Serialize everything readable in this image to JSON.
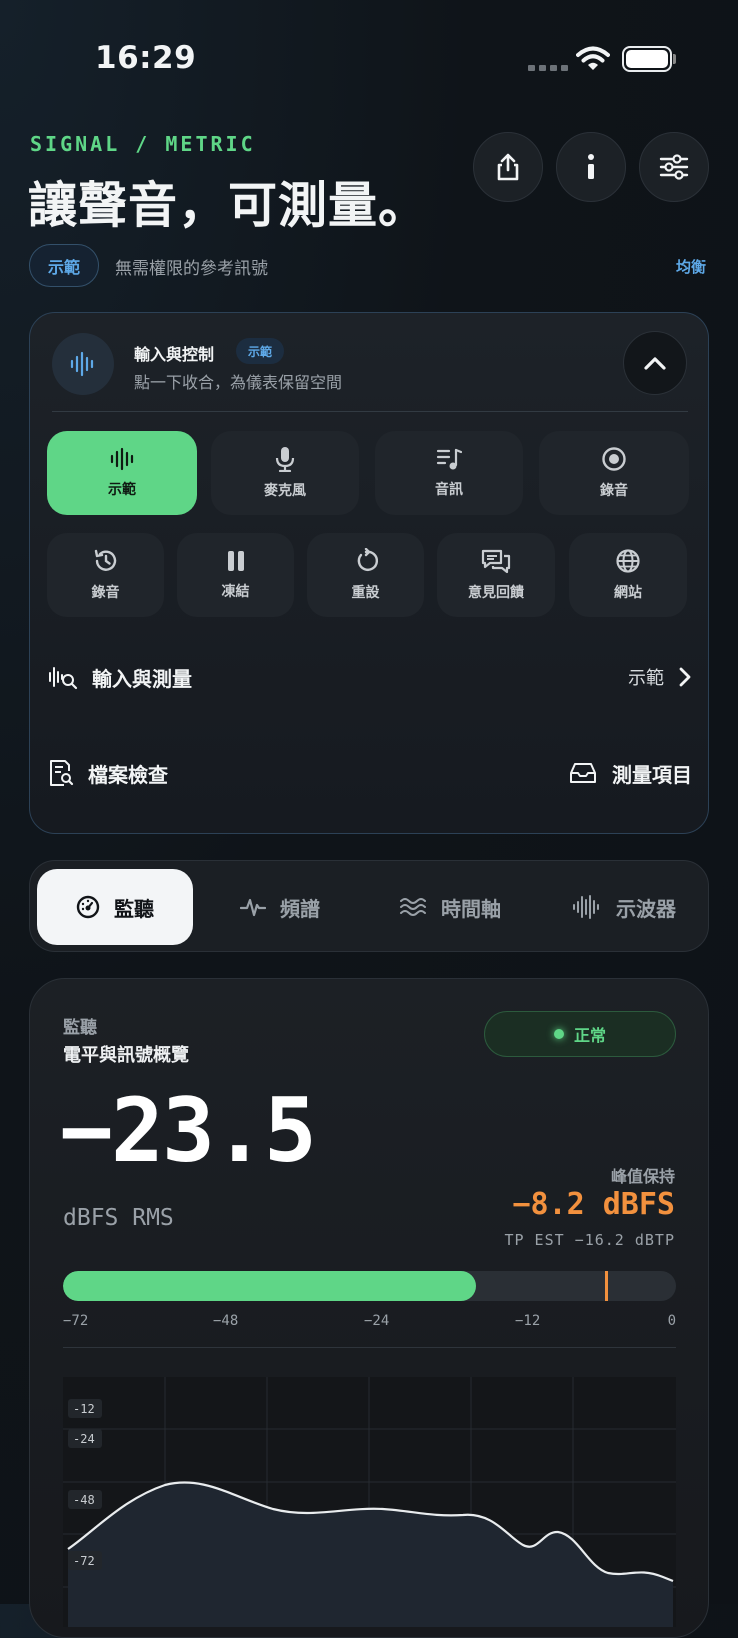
{
  "status_bar": {
    "time": "16:29"
  },
  "header": {
    "eyebrow": "SIGNAL / METRIC",
    "headline": "讓聲音，可測量。",
    "demo_pill": "示範",
    "subline": "無需權限的參考訊號",
    "balance_link": "均衡",
    "actions": [
      "share-icon",
      "info-icon",
      "sliders-icon"
    ]
  },
  "control_card": {
    "title": "輸入與控制",
    "tag": "示範",
    "subtitle": "點一下收合，為儀表保留空間",
    "row1": [
      {
        "label": "示範",
        "icon": "waveform-icon",
        "active": true
      },
      {
        "label": "麥克風",
        "icon": "microphone-icon",
        "active": false
      },
      {
        "label": "音訊",
        "icon": "music-list-icon",
        "active": false
      },
      {
        "label": "錄音",
        "icon": "record-icon",
        "active": false
      }
    ],
    "row2": [
      {
        "label": "錄音",
        "icon": "history-icon"
      },
      {
        "label": "凍結",
        "icon": "pause-icon"
      },
      {
        "label": "重設",
        "icon": "reset-icon"
      },
      {
        "label": "意見回饋",
        "icon": "feedback-icon"
      },
      {
        "label": "網站",
        "icon": "globe-icon"
      }
    ],
    "input_row": {
      "label": "輸入與測量",
      "value": "示範"
    },
    "file_check": "檔案檢查",
    "measure_items": "測量項目"
  },
  "tabs": [
    {
      "label": "監聽",
      "icon": "gauge-icon",
      "active": true
    },
    {
      "label": "頻譜",
      "icon": "pulse-icon",
      "active": false
    },
    {
      "label": "時間軸",
      "icon": "waves-icon",
      "active": false
    },
    {
      "label": "示波器",
      "icon": "oscilloscope-icon",
      "active": false
    }
  ],
  "monitor": {
    "label": "監聽",
    "title": "電平與訊號概覽",
    "status": "正常",
    "value": "−23.5",
    "unit": "dBFS RMS",
    "peak_label": "峰值保持",
    "peak_value": "−8.2 dBFS",
    "tp_est": "TP EST −16.2 dBTP",
    "meter": {
      "min": -72,
      "max": 0,
      "rms": -23.5,
      "peak": -8.2
    },
    "scale": [
      "−72",
      "−48",
      "−24",
      "−12",
      "0"
    ],
    "graph_ticks": [
      "-12",
      "-24",
      "-48",
      "-72"
    ],
    "colors": {
      "accent": "#5fd687",
      "peak": "#f2913e",
      "link": "#5ea9e8"
    }
  }
}
